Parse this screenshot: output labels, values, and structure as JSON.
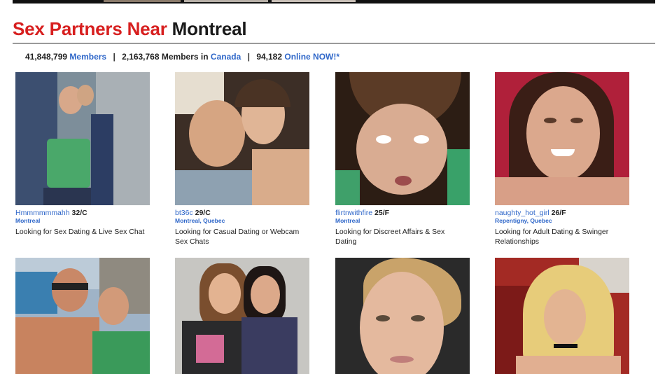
{
  "page": {
    "title_prefix": "Sex Partners Near",
    "title_city": "Montreal"
  },
  "stats": {
    "members_count": "41,848,799",
    "members_label": "Members",
    "sep1": "|",
    "country_members_count": "2,163,768",
    "country_members_text": "Members in",
    "country": "Canada",
    "sep2": "|",
    "online_count": "94,182",
    "online_label": "Online NOW!*"
  },
  "profiles": [
    {
      "username": "Hmmmmmmahh",
      "age_gender": "32/C",
      "location": "Montreal",
      "looking": "Looking for Sex Dating & Live Sex Chat"
    },
    {
      "username": "bt36c",
      "age_gender": "29/C",
      "location": "Montreal, Quebec",
      "looking": "Looking for Casual Dating or Webcam Sex Chats"
    },
    {
      "username": "flirtnwithfire",
      "age_gender": "25/F",
      "location": "Montreal",
      "looking": "Looking for Discreet Affairs & Sex Dating"
    },
    {
      "username": "naughty_hot_girl",
      "age_gender": "26/F",
      "location": "Repentigny, Quebec",
      "looking": "Looking for Adult Dating & Swinger Relationships"
    }
  ],
  "colors": {
    "title_red": "#d71f1f",
    "link_blue": "#2f67c9"
  }
}
